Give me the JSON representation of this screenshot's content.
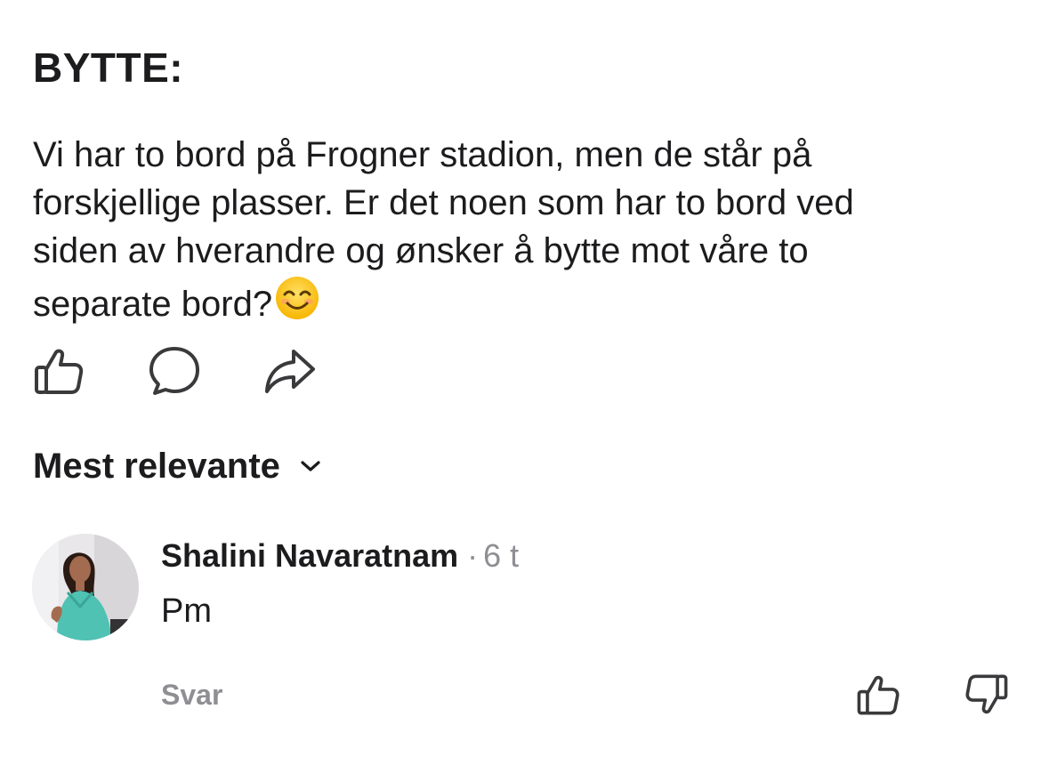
{
  "post": {
    "title": "BYTTE:",
    "body": "Vi har to bord på Frogner stadion, men de står på\nforskjellige plasser. Er det noen som har to bord ved\nsiden av hverandre og ønsker å bytte mot våre to\nseparate bord?",
    "emoji": "smiling-face-emoji"
  },
  "actions": {
    "like_icon": "thumbs-up-icon",
    "comment_icon": "comment-bubble-icon",
    "share_icon": "share-arrow-icon"
  },
  "comments_section": {
    "sort_label": "Mest relevante",
    "sort_icon": "chevron-down-icon"
  },
  "comments": [
    {
      "author": "Shalini Navaratnam",
      "separator": "·",
      "time": "6 t",
      "text": "Pm",
      "reply_label": "Svar",
      "upvote_icon": "thumbs-up-icon",
      "downvote_icon": "thumbs-down-icon"
    }
  ],
  "colors": {
    "text": "#1c1c1e",
    "secondary": "#8e8e93",
    "icon": "#3a3a3c",
    "background": "#ffffff"
  }
}
